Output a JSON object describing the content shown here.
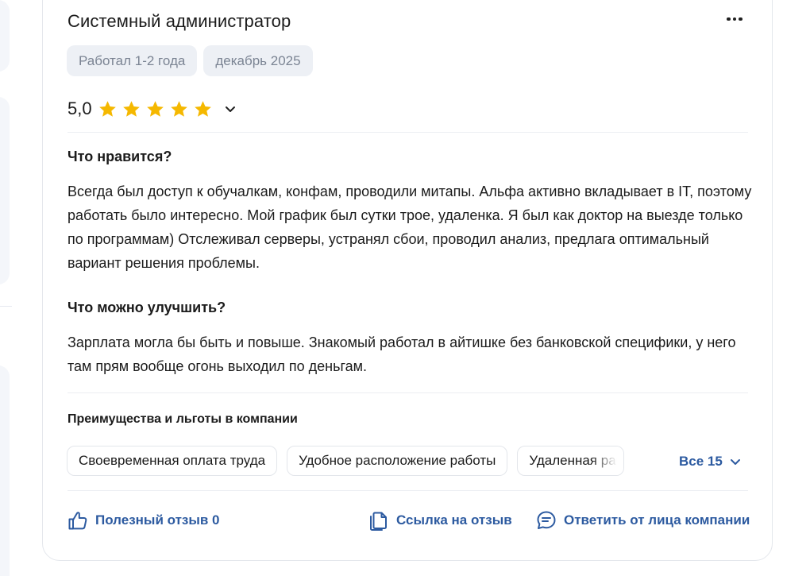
{
  "review": {
    "title": "Системный администратор",
    "tags": [
      "Работал 1-2 года",
      "декабрь 2025"
    ],
    "rating": "5,0",
    "rating_stars": 5,
    "likes_heading": "Что нравится?",
    "likes_text": "Всегда был доступ к обучалкам, конфам, проводили митапы. Альфа активно вкладывает в IT, поэтому работать было интересно. Мой график был сутки трое, удаленка. Я был как доктор на выезде только по программам) Отслеживал серверы, устранял сбои, проводил анализ, предлага оптимальный вариант решения проблемы.",
    "improve_heading": "Что можно улучшить?",
    "improve_text": "Зарплата могла бы быть и повыше. Знакомый работал в айтишке без банковской специфики, у него там прям вообще огонь выходил по деньгам."
  },
  "benefits": {
    "heading": "Преимущества и льготы в компании",
    "chips": [
      "Своевременная оплата труда",
      "Удобное расположение работы",
      "Удаленная работа"
    ],
    "all_label": "Все 15"
  },
  "actions": {
    "useful": "Полезный отзыв 0",
    "link": "Ссылка на отзыв",
    "reply": "Ответить от лица компании"
  },
  "colors": {
    "accent": "#2c5aa0",
    "star": "#f5b800",
    "tag_bg": "#edf0f5",
    "tag_text": "#7b8493"
  }
}
